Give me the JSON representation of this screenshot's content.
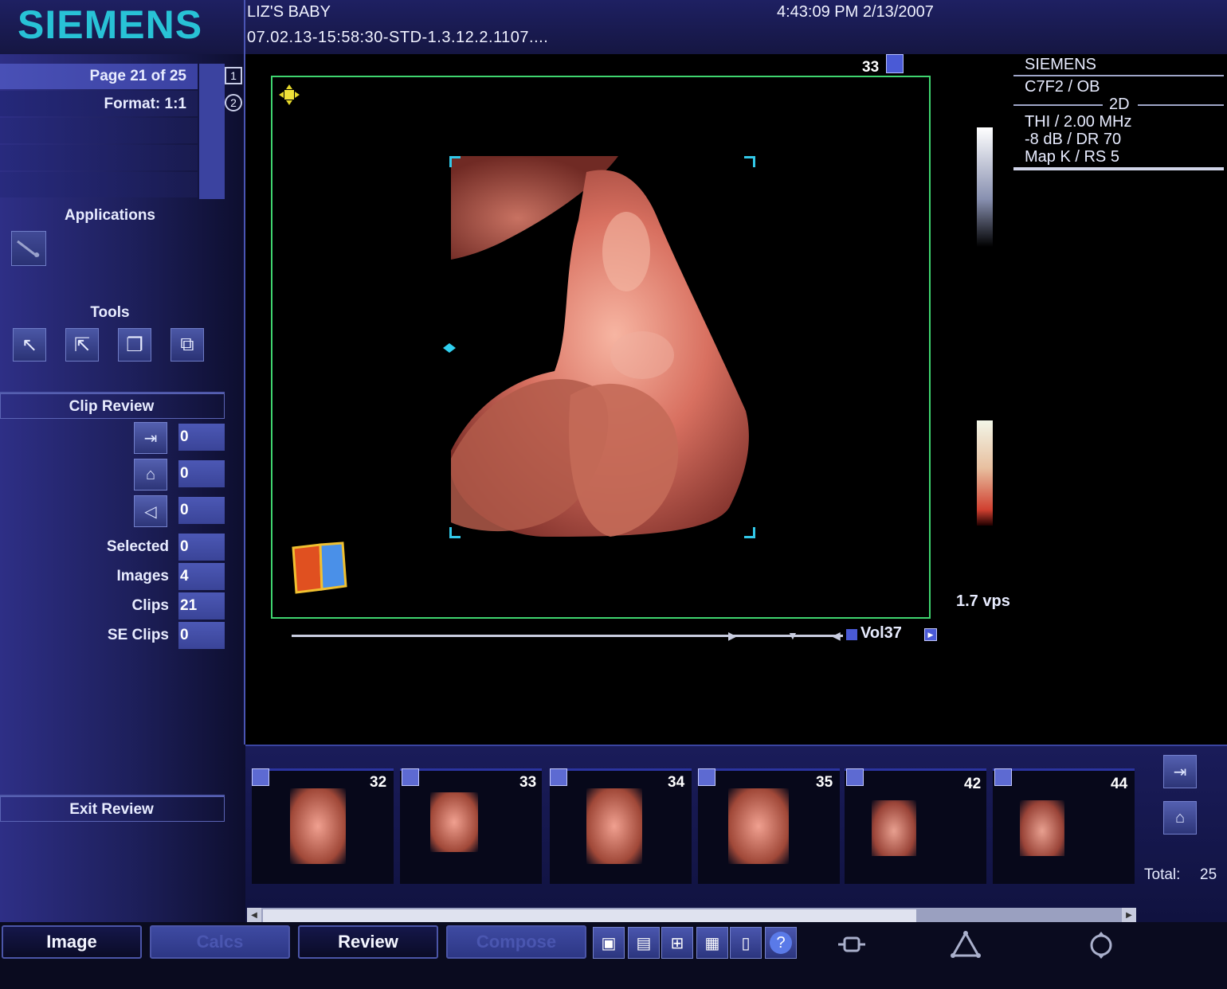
{
  "brand": "SIEMENS",
  "header": {
    "patient": "LIZ'S BABY",
    "study_id": "07.02.13-15:58:30-STD-1.3.12.2.1107....",
    "datetime": "4:43:09 PM 2/13/2007"
  },
  "left_panel": {
    "page_label": "Page 21 of 25",
    "format_label": "Format: 1:1",
    "page_btn_1": "1",
    "page_btn_2": "2",
    "applications_title": "Applications",
    "tools_title": "Tools",
    "clip_review_title": "Clip Review",
    "clip_values": [
      "0",
      "0",
      "0"
    ],
    "stats": [
      {
        "label": "Selected",
        "value": "0"
      },
      {
        "label": "Images",
        "value": "4"
      },
      {
        "label": "Clips",
        "value": "21"
      },
      {
        "label": "SE Clips",
        "value": "0"
      }
    ],
    "exit_review": "Exit Review"
  },
  "viewer": {
    "frame_number": "33",
    "vps": "1.7 vps",
    "volume_label": "Vol37"
  },
  "info_panel": {
    "vendor": "SIEMENS",
    "transducer": "C7F2 / OB",
    "mode": "2D",
    "thi": "THI / 2.00 MHz",
    "gain": "-8 dB / DR 70",
    "map": "Map K / RS 5"
  },
  "thumbnails": [
    {
      "number": "32",
      "type": "clip"
    },
    {
      "number": "33",
      "type": "image"
    },
    {
      "number": "34",
      "type": "clip"
    },
    {
      "number": "35",
      "type": "clip"
    },
    {
      "number": "42",
      "type": "image"
    },
    {
      "number": "44",
      "type": "image"
    }
  ],
  "strip": {
    "total_label": "Total:",
    "total_value": "25"
  },
  "tabs": {
    "image": "Image",
    "calcs": "Calcs",
    "review": "Review",
    "compose": "Compose"
  },
  "colors": {
    "brand": "#28c2d6",
    "frame_border": "#3fd46f",
    "accent_blue": "#4c58b5"
  }
}
